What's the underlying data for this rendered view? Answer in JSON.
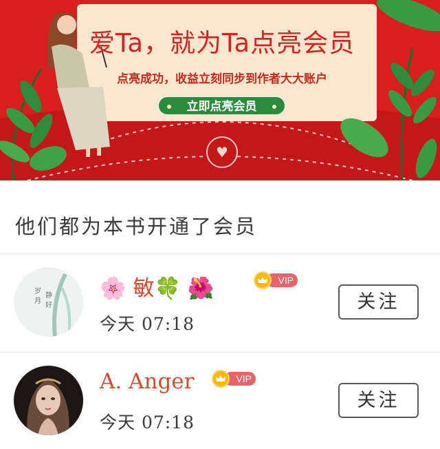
{
  "banner": {
    "title": "爱Ta，就为Ta点亮会员",
    "subtitle": "点亮成功，收益立刻同步到作者大大账户",
    "cta_label": "立即点亮会员",
    "colors": {
      "background": "#d81f1f",
      "card": "#fbe7cf",
      "accent": "#d7231f",
      "button": "#2b8a3e"
    }
  },
  "section": {
    "title": "他们都为本书开通了会员"
  },
  "members": [
    {
      "name": "🌸 敏🍀 🌺",
      "badge": "VIP",
      "time": "今天 07:18",
      "follow_label": "关注",
      "avatar_icon": "calligraphy-landscape-avatar"
    },
    {
      "name": "A. Anger",
      "badge": "VIP",
      "time": "今天 07:18",
      "follow_label": "关注",
      "avatar_icon": "illustrated-girl-avatar"
    }
  ]
}
